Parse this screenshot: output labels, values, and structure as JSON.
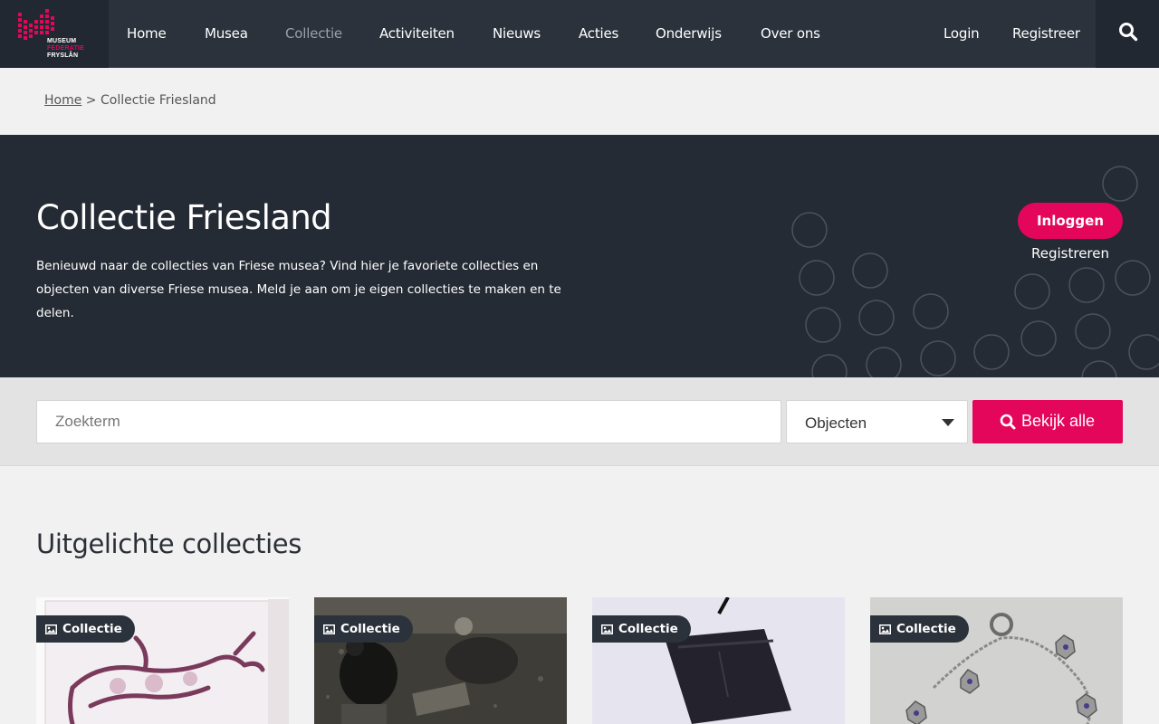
{
  "brand": {
    "logo_line1": "MUSEUM",
    "logo_line2": "FEDERATIE",
    "logo_line3": "FRYSLÂN",
    "accent_color": "#e3065b"
  },
  "nav": {
    "items": [
      {
        "label": "Home"
      },
      {
        "label": "Musea"
      },
      {
        "label": "Collectie",
        "active": true
      },
      {
        "label": "Activiteiten"
      },
      {
        "label": "Nieuws"
      },
      {
        "label": "Acties"
      },
      {
        "label": "Onderwijs"
      },
      {
        "label": "Over ons"
      }
    ],
    "login": "Login",
    "register": "Registreer",
    "search_icon": "search-icon"
  },
  "breadcrumb": {
    "home": "Home",
    "separator": ">",
    "current": "Collectie Friesland"
  },
  "hero": {
    "title": "Collectie Friesland",
    "description": "Benieuwd naar de collecties van Friese musea? Vind hier je favoriete collecties en objecten van diverse Friese musea. Meld je aan om je eigen collecties te maken en te delen.",
    "login_button": "Inloggen",
    "register_link": "Registreren"
  },
  "search": {
    "placeholder": "Zoekterm",
    "value": "",
    "type_selected": "Objecten",
    "button_label": "Bekijk alle"
  },
  "featured": {
    "title": "Uitgelichte collecties",
    "cards": [
      {
        "tag": "Collectie",
        "image": "tile-with-cow"
      },
      {
        "tag": "Collectie",
        "image": "farm-workers-photo"
      },
      {
        "tag": "Collectie",
        "image": "dark-cloth-bag"
      },
      {
        "tag": "Collectie",
        "image": "silver-chain-jewelry"
      }
    ]
  }
}
